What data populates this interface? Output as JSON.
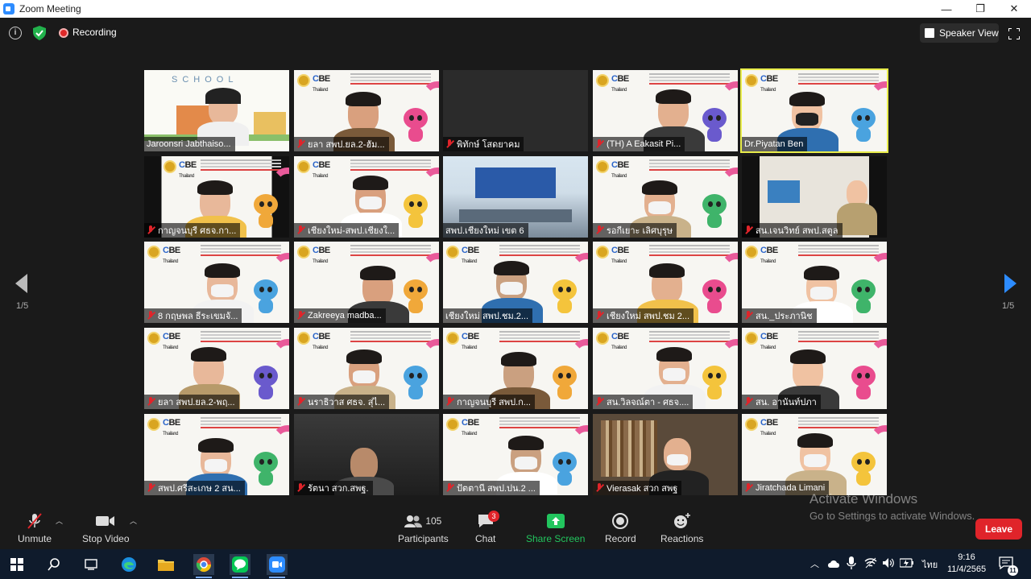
{
  "window": {
    "title": "Zoom Meeting",
    "controls": [
      "—",
      "❐",
      "✕"
    ]
  },
  "topbar": {
    "recording_label": "Recording",
    "view_label": "Speaker View"
  },
  "pager": {
    "left_count": "1/5",
    "right_count": "1/5"
  },
  "participants": [
    {
      "name": "Jaroonsri Jabthaiso...",
      "muted": false,
      "bg": "school"
    },
    {
      "name": "ยลา สพป.ยล.2-ฮัม...",
      "muted": true,
      "bg": "cbe"
    },
    {
      "name": "พิทักษ์ โสดยาคม",
      "muted": true,
      "bg": "dark"
    },
    {
      "name": "(TH) A Eakasit Pi...",
      "muted": true,
      "bg": "cbe"
    },
    {
      "name": "Dr.Piyatan Ben",
      "muted": false,
      "bg": "cbe",
      "speaking": true
    },
    {
      "name": "กาญจนบุรี ศธจ.กา...",
      "muted": true,
      "bg": "cbe-narrow"
    },
    {
      "name": "เชียงใหม่-สพป.เชียงใ...",
      "muted": true,
      "bg": "cbe"
    },
    {
      "name": "สพป.เชียงใหม่ เขต 6",
      "muted": false,
      "bg": "room"
    },
    {
      "name": "รอกีเยาะ เลิศบุรุษ",
      "muted": true,
      "bg": "cbe"
    },
    {
      "name": "สน.เจนวิทย์ สพป.สตูล",
      "muted": true,
      "bg": "office"
    },
    {
      "name": "8 กฤษพล ธีระเขมจั...",
      "muted": true,
      "bg": "cbe"
    },
    {
      "name": "Zakreeya madba...",
      "muted": true,
      "bg": "cbe"
    },
    {
      "name": "เชียงใหม่ สพป.ชม.2...",
      "muted": false,
      "bg": "cbe"
    },
    {
      "name": "เชียงใหม่ สพป.ชม 2...",
      "muted": true,
      "bg": "cbe"
    },
    {
      "name": "สน._ประภานิช",
      "muted": true,
      "bg": "cbe"
    },
    {
      "name": "ยลา สพป.ยล.2-พฤ...",
      "muted": true,
      "bg": "cbe"
    },
    {
      "name": "นราธิวาส ศธจ. สุ่ไ...",
      "muted": true,
      "bg": "cbe"
    },
    {
      "name": "กาญจนบุรี สพป.ก...",
      "muted": true,
      "bg": "cbe"
    },
    {
      "name": "สน.วิลจณ์ตา - ศธจ....",
      "muted": true,
      "bg": "cbe"
    },
    {
      "name": "สน. อานันท์ปภา",
      "muted": true,
      "bg": "cbe"
    },
    {
      "name": "สพป.ศรีสะเกษ 2 สน...",
      "muted": true,
      "bg": "cbe"
    },
    {
      "name": "รัตนา สวก.สพฐ.",
      "muted": true,
      "bg": "dark2"
    },
    {
      "name": "ปัตตานี สพป.ปน.2 ...",
      "muted": true,
      "bg": "cbe"
    },
    {
      "name": "Vierasak สวก สพฐ",
      "muted": true,
      "bg": "library"
    },
    {
      "name": "Jiratchada Limani",
      "muted": true,
      "bg": "cbe"
    }
  ],
  "toolbar": {
    "unmute": "Unmute",
    "stop_video": "Stop Video",
    "participants": "Participants",
    "participants_count": "105",
    "chat": "Chat",
    "chat_badge": "3",
    "share_screen": "Share Screen",
    "record": "Record",
    "reactions": "Reactions",
    "leave": "Leave"
  },
  "watermark": {
    "line1": "Activate Windows",
    "line2": "Go to Settings to activate Windows."
  },
  "taskbar": {
    "time": "9:16",
    "date": "11/4/2565",
    "lang": "ไทย",
    "notif_count": "11"
  },
  "colors": {
    "accent": "#2d8cff",
    "leave": "#e0242a",
    "speaking": "#e8ec4a",
    "share": "#22c55e"
  }
}
